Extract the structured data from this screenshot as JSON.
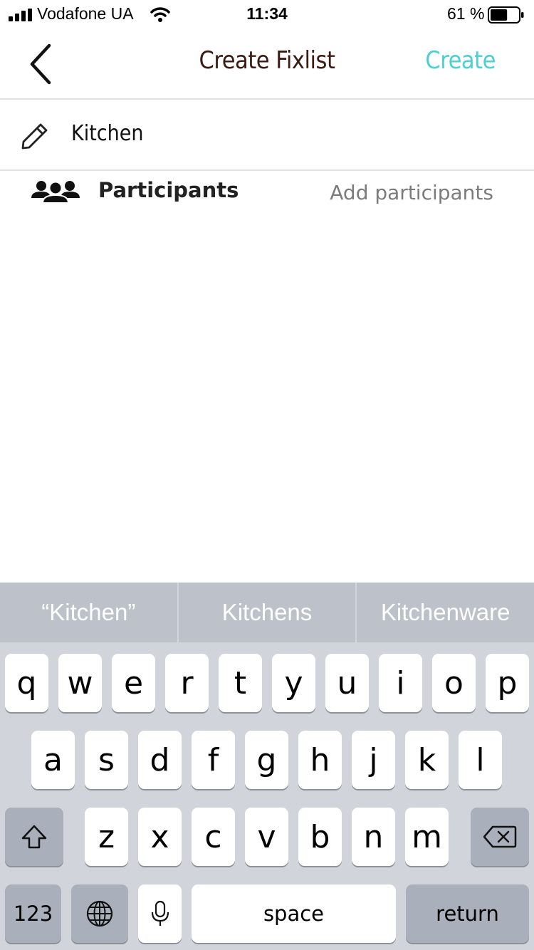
{
  "status_bar": {
    "carrier": "Vodafone UA",
    "time": "11:34",
    "battery_percent": "61 %",
    "battery_level": 0.61
  },
  "nav": {
    "title": "Create Fixlist",
    "create_label": "Create"
  },
  "form": {
    "name_value": "Kitchen",
    "participants_label": "Participants",
    "add_participants_label": "Add participants"
  },
  "keyboard": {
    "suggestions": [
      "“Kitchen”",
      "Kitchens",
      "Kitchenware"
    ],
    "row1": [
      "q",
      "w",
      "e",
      "r",
      "t",
      "y",
      "u",
      "i",
      "o",
      "p"
    ],
    "row2": [
      "a",
      "s",
      "d",
      "f",
      "g",
      "h",
      "j",
      "k",
      "l"
    ],
    "row3": [
      "z",
      "x",
      "c",
      "v",
      "b",
      "n",
      "m"
    ],
    "numbers_label": "123",
    "space_label": "space",
    "return_label": "return"
  },
  "colors": {
    "accent": "#4cd1cf",
    "title": "#3a1a12"
  }
}
